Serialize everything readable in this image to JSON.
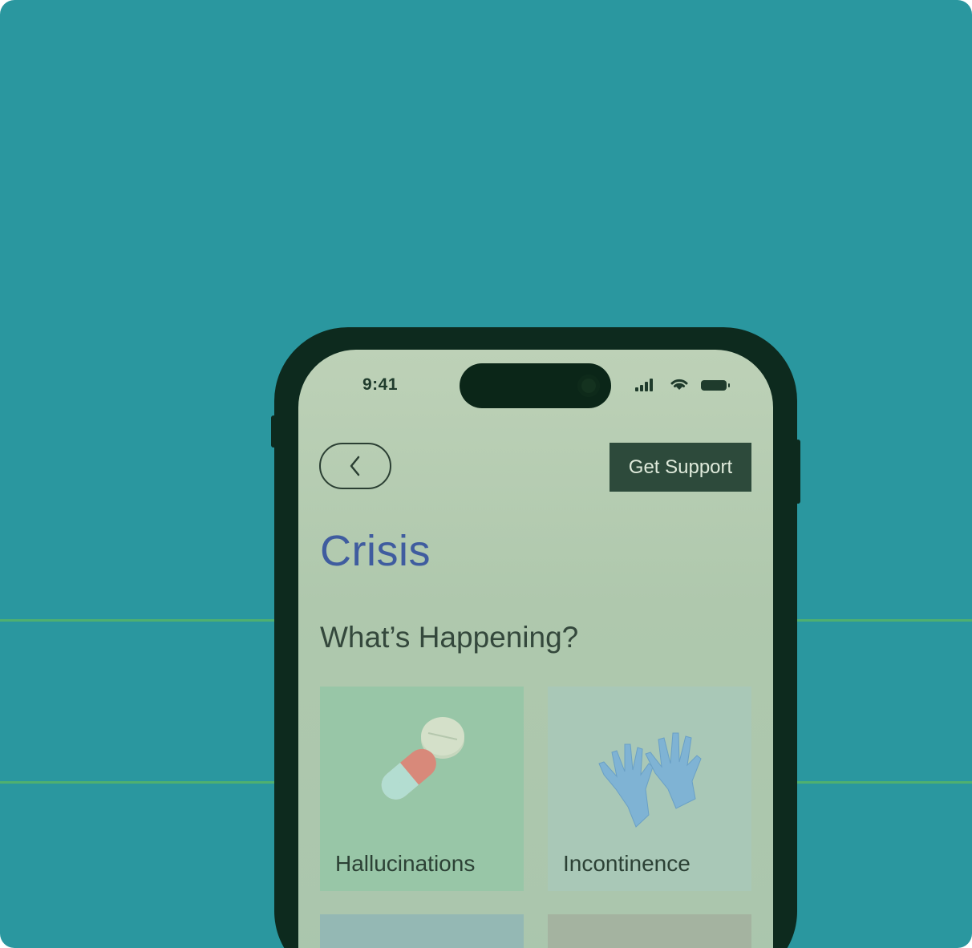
{
  "status_bar": {
    "time": "9:41",
    "icons": [
      "signal-icon",
      "wifi-icon",
      "battery-icon"
    ]
  },
  "header": {
    "back_icon": "chevron-left-icon",
    "support_label": "Get Support"
  },
  "page": {
    "title": "Crisis",
    "section_heading": "What’s Happening?"
  },
  "cards": [
    {
      "label": "Hallucinations",
      "icon": "pills-icon"
    },
    {
      "label": "Incontinence",
      "icon": "gloves-icon"
    },
    {
      "label": "",
      "icon": ""
    },
    {
      "label": "",
      "icon": ""
    }
  ],
  "colors": {
    "background": "#2a979f",
    "accent_line": "#4fb06f",
    "phone_frame": "#0d2a1e",
    "screen": "#b4cdb2",
    "title": "#3f5c9f",
    "support_button": "#2d4a3b"
  }
}
